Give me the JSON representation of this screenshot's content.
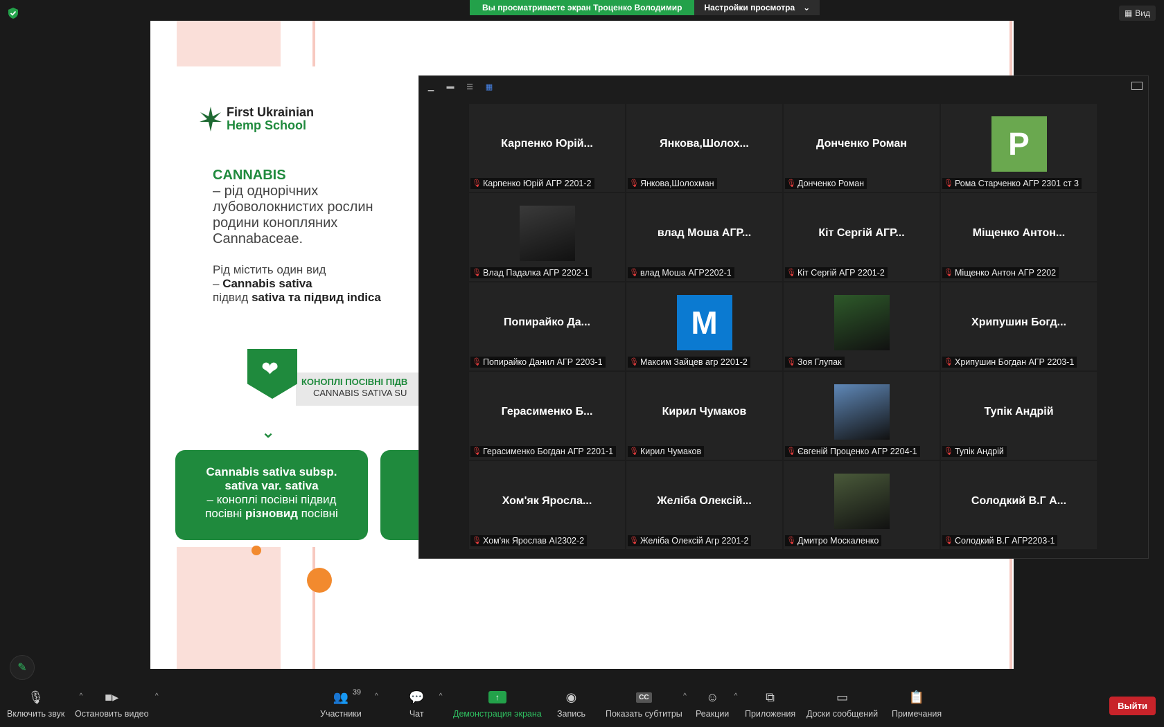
{
  "window": {
    "share_banner": {
      "viewing": "Вы просматриваете экран Троценко Володимир",
      "options": "Настройки просмотра"
    },
    "view_button": "Вид"
  },
  "slide": {
    "brand_line1": "First Ukrainian",
    "brand_line2": "Hemp School",
    "heading": "CANNABIS",
    "desc_line1": "– рід однорічних",
    "desc_line2": "лубоволокнистих рослин",
    "desc_line3": "родини конопляних",
    "desc_line4": "Cannabaceae.",
    "species_line1": "Рід містить один вид",
    "species_line2_prefix": "– ",
    "species_line2_bold": "Cannabis sativa",
    "species_line3_prefix": "підвид ",
    "species_line3_bold": "sativa та підвид indica",
    "banner_line1": "КОНОПЛІ ПОСІВНІ ПІДВ",
    "banner_line2": "CANNABIS SATIVA SU",
    "box_line1": "Cannabis sativa subsp.",
    "box_line2": "sativa var. sativa",
    "box_line3": "– коноплі посівні підвид",
    "box_line4_prefix": "посівні ",
    "box_line4_bold": "різновид",
    "box_line4_suffix": " посівні"
  },
  "gallery": {
    "tiles": [
      {
        "display": "Карпенко Юрій...",
        "label": "Карпенко Юрій АГР 2201-2",
        "type": "name"
      },
      {
        "display": "Янкова,Шолох...",
        "label": "Янкова,Шолохман",
        "type": "name"
      },
      {
        "display": "Донченко Роман",
        "label": "Донченко Роман",
        "type": "name"
      },
      {
        "display": "P",
        "label": "Рома Старченко АГР 2301 ст 3",
        "type": "avatar",
        "color": "#6aa84f"
      },
      {
        "display": "",
        "label": "Влад Падалка АГР 2202-1",
        "type": "photo",
        "color": "#3a3a3a"
      },
      {
        "display": "влад Моша АГР...",
        "label": "влад Моша АГР2202-1",
        "type": "name"
      },
      {
        "display": "Кіт Сергій АГР...",
        "label": "Кіт Сергій АГР 2201-2",
        "type": "name"
      },
      {
        "display": "Міщенко Антон...",
        "label": "Міщенко Антон АГР 2202",
        "type": "name"
      },
      {
        "display": "Попирайко Да...",
        "label": "Попирайко Данил АГР 2203-1",
        "type": "name"
      },
      {
        "display": "M",
        "label": "Максим Зайцев агр 2201-2",
        "type": "avatar",
        "color": "#0b7ad1"
      },
      {
        "display": "",
        "label": "Зоя Глупак",
        "type": "photo",
        "color": "#2e5a2a"
      },
      {
        "display": "Хрипушин Богд...",
        "label": "Хрипушин Богдан АГР 2203-1",
        "type": "name"
      },
      {
        "display": "Герасименко Б...",
        "label": "Герасименко Богдан АГР 2201-1",
        "type": "name"
      },
      {
        "display": "Кирил Чумаков",
        "label": "Кирил Чумаков",
        "type": "name"
      },
      {
        "display": "",
        "label": "Євгеній Проценко АГР 2204-1",
        "type": "photo",
        "color": "#5f88b8"
      },
      {
        "display": "Тупік Андрій",
        "label": "Тупік Андрій",
        "type": "name"
      },
      {
        "display": "Хом'як Яросла...",
        "label": "Хом'як Ярослав АІ2302-2",
        "type": "name"
      },
      {
        "display": "Желіба Олексій...",
        "label": "Желіба Олексій Агр 2201-2",
        "type": "name"
      },
      {
        "display": "",
        "label": "Дмитро Москаленко",
        "type": "photo",
        "color": "#4a5a3a"
      },
      {
        "display": "Солодкий В.Г А...",
        "label": "Солодкий В.Г АГР2203-1",
        "type": "name"
      }
    ]
  },
  "toolbar": {
    "mute": "Включить звук",
    "video": "Остановить видео",
    "participants": "Участники",
    "participants_count": "39",
    "chat": "Чат",
    "share": "Демонстрация экрана",
    "record": "Запись",
    "captions": "Показать субтитры",
    "reactions": "Реакции",
    "apps": "Приложения",
    "whiteboards": "Доски сообщений",
    "notes": "Примечания",
    "exit": "Выйти"
  }
}
